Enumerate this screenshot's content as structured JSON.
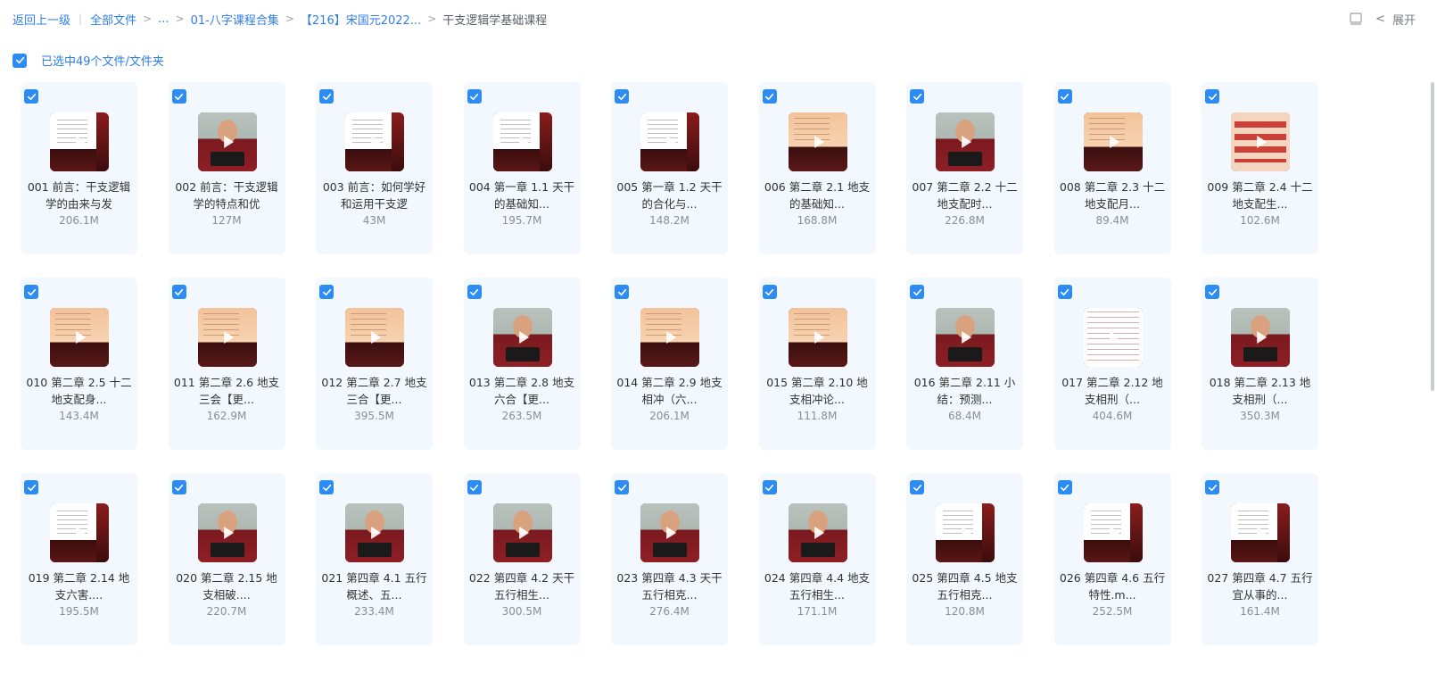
{
  "breadcrumb": {
    "back": "返回上一级",
    "all_files": "全部文件",
    "ellipsis": "...",
    "item1": "01-八字课程合集",
    "item2": "【216】宋国元2022...",
    "current": "干支逻辑学基础课程"
  },
  "toolbar": {
    "expand_label": "展开",
    "layout_icon": "panel-icon"
  },
  "selection": {
    "text": "已选中49个文件/文件夹",
    "checked": true
  },
  "colors": {
    "accent": "#2f7ee8",
    "checkbox": "#2c8cf4",
    "card_bg": "#f2f8fd"
  },
  "files": [
    {
      "name": "001 前言：干支逻辑学的由来与发",
      "size": "206.1M",
      "thumb": "slide"
    },
    {
      "name": "002 前言：干支逻辑学的特点和优",
      "size": "127M",
      "thumb": "man"
    },
    {
      "name": "003 前言：如何学好和运用干支逻",
      "size": "43M",
      "thumb": "slide"
    },
    {
      "name": "004 第一章 1.1 天干的基础知...",
      "size": "195.7M",
      "thumb": "slide"
    },
    {
      "name": "005 第一章 1.2 天干的合化与...",
      "size": "148.2M",
      "thumb": "slide"
    },
    {
      "name": "006 第二章 2.1 地支的基础知...",
      "size": "168.8M",
      "thumb": "orange"
    },
    {
      "name": "007 第二章 2.2 十二地支配时...",
      "size": "226.8M",
      "thumb": "man"
    },
    {
      "name": "008 第二章 2.3 十二地支配月...",
      "size": "89.4M",
      "thumb": "orange"
    },
    {
      "name": "009 第二章 2.4 十二地支配生...",
      "size": "102.6M",
      "thumb": "red"
    },
    {
      "name": "010 第二章 2.5 十二地支配身...",
      "size": "143.4M",
      "thumb": "orange"
    },
    {
      "name": "011 第二章 2.6 地支三会【更...",
      "size": "162.9M",
      "thumb": "orange"
    },
    {
      "name": "012 第二章 2.7 地支三合【更...",
      "size": "395.5M",
      "thumb": "orange"
    },
    {
      "name": "013 第二章 2.8 地支六合【更...",
      "size": "263.5M",
      "thumb": "man"
    },
    {
      "name": "014 第二章 2.9 地支相冲（六...",
      "size": "206.1M",
      "thumb": "orange"
    },
    {
      "name": "015 第二章 2.10 地支相冲论...",
      "size": "111.8M",
      "thumb": "orange"
    },
    {
      "name": "016 第二章 2.11 小结：预测...",
      "size": "68.4M",
      "thumb": "man"
    },
    {
      "name": "017 第二章 2.12 地支相刑（...",
      "size": "404.6M",
      "thumb": "white"
    },
    {
      "name": "018 第二章 2.13 地支相刑（...",
      "size": "350.3M",
      "thumb": "man"
    },
    {
      "name": "019 第二章 2.14 地支六害....",
      "size": "195.5M",
      "thumb": "slide"
    },
    {
      "name": "020 第二章 2.15 地支相破....",
      "size": "220.7M",
      "thumb": "man"
    },
    {
      "name": "021 第四章 4.1 五行概述、五...",
      "size": "233.4M",
      "thumb": "man"
    },
    {
      "name": "022 第四章 4.2 天干五行相生...",
      "size": "300.5M",
      "thumb": "man"
    },
    {
      "name": "023 第四章 4.3 天干五行相克...",
      "size": "276.4M",
      "thumb": "man"
    },
    {
      "name": "024 第四章 4.4 地支五行相生...",
      "size": "171.1M",
      "thumb": "man"
    },
    {
      "name": "025 第四章 4.5 地支五行相克...",
      "size": "120.8M",
      "thumb": "slide"
    },
    {
      "name": "026 第四章 4.6 五行特性.m...",
      "size": "252.5M",
      "thumb": "slide"
    },
    {
      "name": "027 第四章 4.7 五行宜从事的...",
      "size": "161.4M",
      "thumb": "slide"
    }
  ]
}
